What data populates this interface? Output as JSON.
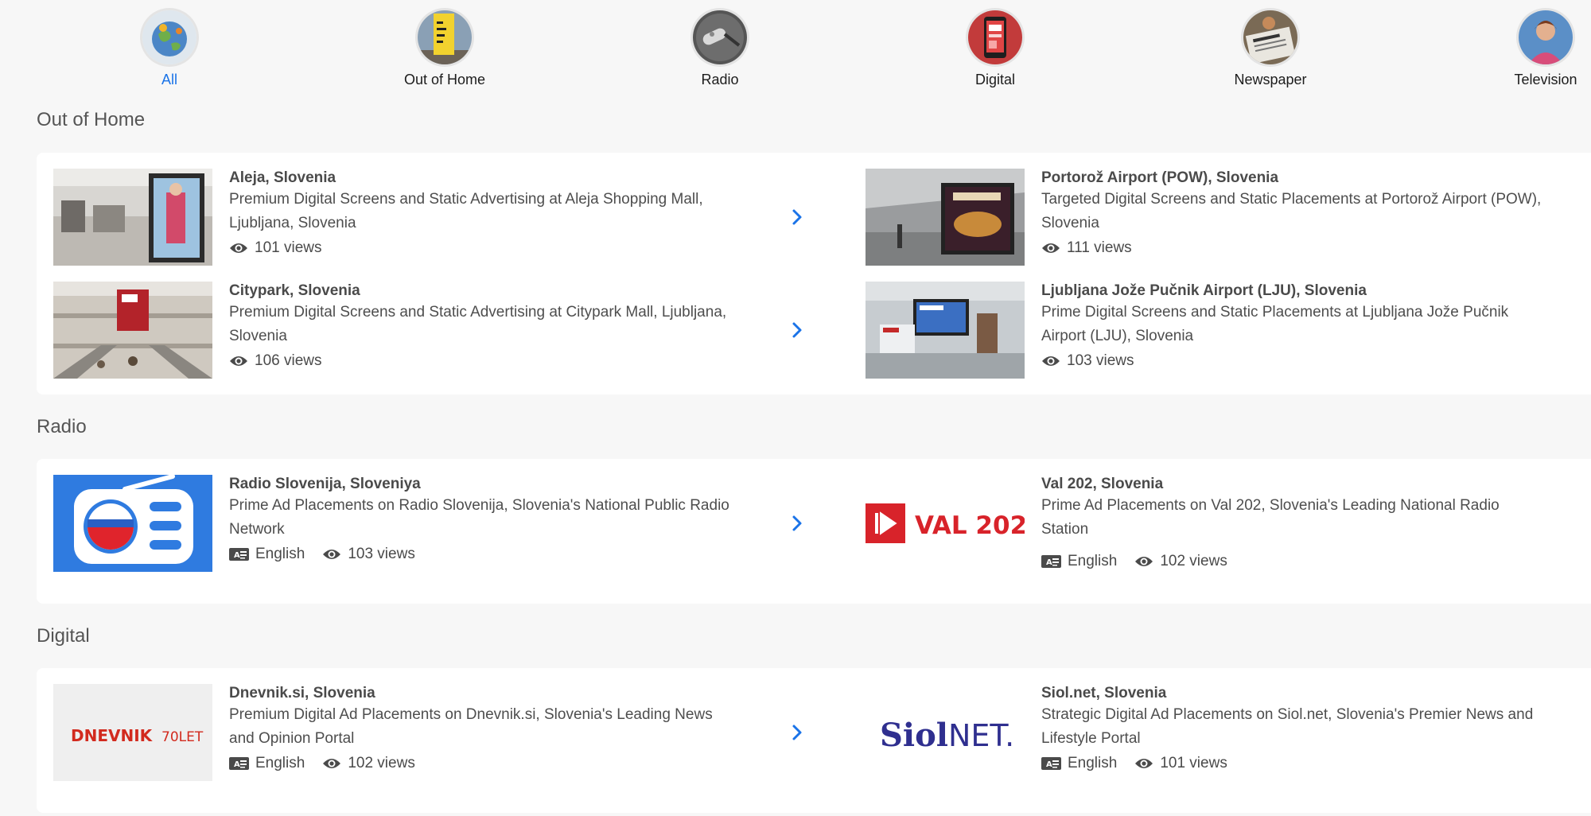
{
  "categories": [
    {
      "label": "All",
      "icon": "globe-map-icon",
      "active": true
    },
    {
      "label": "Out of Home",
      "icon": "billboard-icon",
      "active": false
    },
    {
      "label": "Radio",
      "icon": "microphone-icon",
      "active": false
    },
    {
      "label": "Digital",
      "icon": "phone-icon",
      "active": false
    },
    {
      "label": "Newspaper",
      "icon": "newspaper-icon",
      "active": false
    },
    {
      "label": "Television",
      "icon": "tv-presenter-icon",
      "active": false
    }
  ],
  "sections": {
    "ooh": {
      "title": "Out of Home",
      "items": [
        {
          "title": "Aleja, Slovenia",
          "desc": "Premium Digital Screens and Static Advertising at Aleja Shopping Mall, Ljubljana, Slovenia",
          "views": "101 views"
        },
        {
          "title": "Portorož Airport (POW), Slovenia",
          "desc": "Targeted Digital Screens and Static Placements at Portorož Airport (POW), Slovenia",
          "views": "111 views"
        },
        {
          "title": "Citypark, Slovenia",
          "desc": "Premium Digital Screens and Static Advertising at Citypark Mall, Ljubljana, Slovenia",
          "views": "106 views"
        },
        {
          "title": "Ljubljana Jože Pučnik Airport (LJU), Slovenia",
          "desc": "Prime Digital Screens and Static Placements at Ljubljana Jože Pučnik Airport (LJU), Slovenia",
          "views": "103 views"
        }
      ]
    },
    "radio": {
      "title": "Radio",
      "items": [
        {
          "title": "Radio Slovenija, Sloveniya",
          "desc": "Prime Ad Placements on Radio Slovenija, Slovenia's National Public Radio Network",
          "language": "English",
          "views": "103 views"
        },
        {
          "title": "Val 202, Slovenia",
          "desc": "Prime Ad Placements on Val 202, Slovenia's Leading National Radio Station",
          "language": "English",
          "views": "102 views",
          "logo_text": "VAL 202"
        }
      ]
    },
    "digital": {
      "title": "Digital",
      "items": [
        {
          "title": "Dnevnik.si, Slovenia",
          "desc": "Premium Digital Ad Placements on Dnevnik.si, Slovenia's Leading News and Opinion Portal",
          "language": "English",
          "views": "102 views",
          "logo_text": "DNEVNIK",
          "logo_sub": "70LET"
        },
        {
          "title": "Siol.net, Slovenia",
          "desc": "Strategic Digital Ad Placements on Siol.net, Slovenia's Premier News and Lifestyle Portal",
          "language": "English",
          "views": "101 views",
          "logo_text": "Siol",
          "logo_sub": "NET."
        }
      ]
    }
  },
  "colors": {
    "accent": "#1a73e8",
    "val202_red": "#d8232a",
    "dnevnik_red": "#d22a1e",
    "siol_blue": "#2f2f8f"
  }
}
